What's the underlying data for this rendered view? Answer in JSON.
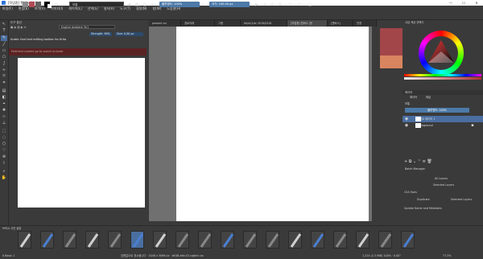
{
  "window": {
    "title": "[작업중] 캔버스 (Krita)"
  },
  "menu": [
    "파일(F)",
    "편집(E)",
    "보기(V)",
    "이미지(I)",
    "레이어(L)",
    "선택(S)",
    "필터(R)",
    "도구(T)",
    "설정(N)",
    "창(W)",
    "도움말(H)"
  ],
  "toolbar": {
    "blend_mode": "보통",
    "opacity": "불투명도: 100%",
    "size": "크기: 100.00 px"
  },
  "tool_options": {
    "header": "도구 옵션",
    "font": "English Ambient 3h1",
    "size_label": "Strength: 98%",
    "size2_label": "Size: 0.00 px",
    "hint": "Pertinent content go to search to bcale"
  },
  "tabs": [
    "present on",
    "경로아래",
    "그렙",
    "fol/ol/1/ar 2019/0101",
    "[작업중] 캔버스 (문",
    "[캔버스]",
    "전경"
  ],
  "color_panel": {
    "header": "고급 색상 선택기",
    "fg_color": "#a3464a",
    "bg_color": "#d9855f"
  },
  "layers": {
    "header": "레이어",
    "tabs": [
      "레이어",
      "채널"
    ],
    "mode": "보통",
    "opacity": "불투명도: 100%",
    "items": [
      {
        "name": "페인트 레이어 1",
        "selected": true
      },
      {
        "name": "Background",
        "selected": false
      }
    ]
  },
  "assets": {
    "header": "Batch Manager",
    "lines": [
      "All Layers",
      "Selected Layers",
      "CSA Tools",
      "Duplicate",
      "Selected Layers",
      "Update Name and Metadata"
    ]
  },
  "brush_presets": {
    "header": "브러시 사전 설정",
    "count": 18
  },
  "status": {
    "left": "0 Basic-1",
    "center": "흐름값으로 표시됩니다 · 2048 x 3096 px · sRGB-elle-V2-srgbtrc.icc",
    "right": "1,224 (2.3 MiB) 100% · 0.00°",
    "zoom": "77.3%"
  }
}
